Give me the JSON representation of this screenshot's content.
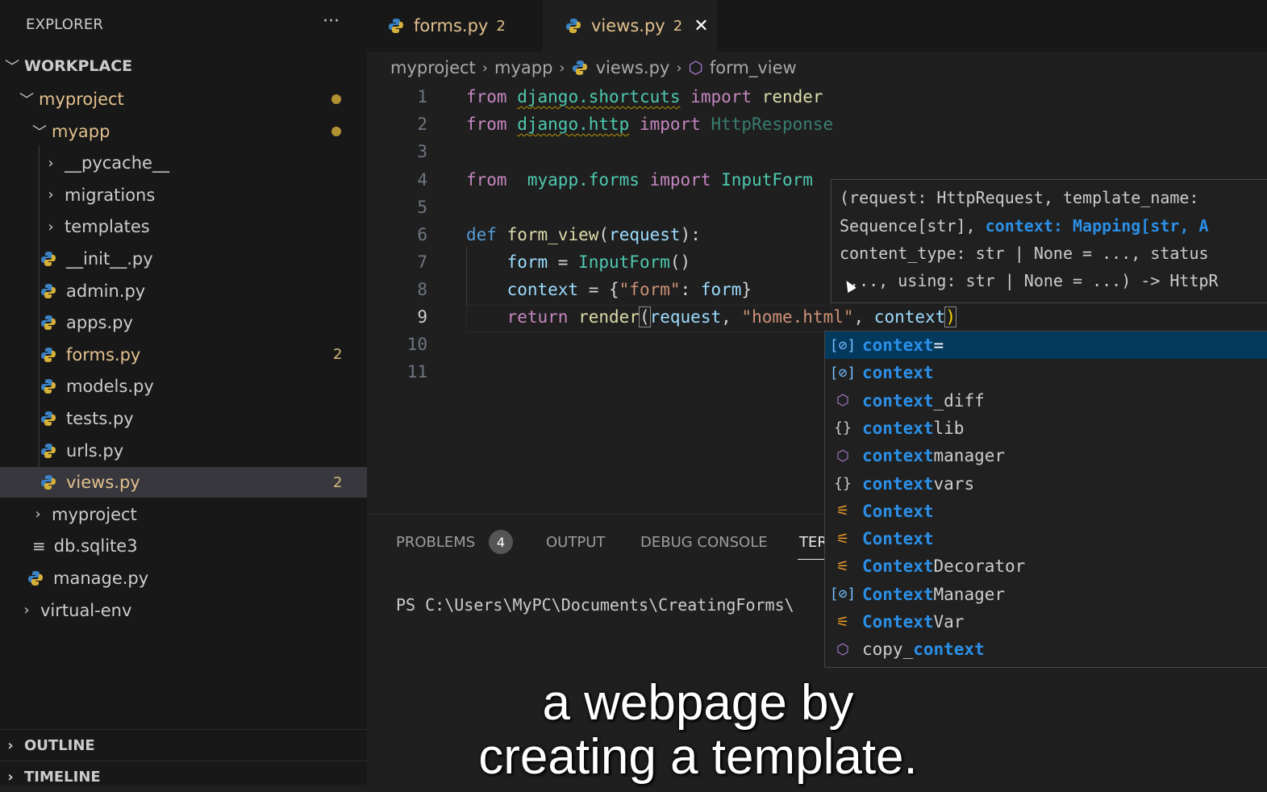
{
  "explorer": {
    "title": "EXPLORER",
    "more": "···",
    "workspace": "WORKPLACE",
    "tree": [
      {
        "label": "myproject",
        "chevron": "﹀",
        "color": "#e2c08d"
      },
      {
        "label": "myapp",
        "chevron": "﹀",
        "color": "#e2c08d"
      },
      {
        "label": "__pycache__",
        "chevron": "›",
        "color": "#cccccc"
      },
      {
        "label": "migrations",
        "chevron": "›",
        "color": "#cccccc"
      },
      {
        "label": "templates",
        "chevron": "›",
        "color": "#cccccc"
      },
      {
        "label": "__init__.py",
        "color": "#cccccc"
      },
      {
        "label": "admin.py",
        "color": "#cccccc"
      },
      {
        "label": "apps.py",
        "color": "#cccccc"
      },
      {
        "label": "forms.py",
        "badge": "2",
        "color": "#e2c08d"
      },
      {
        "label": "models.py",
        "color": "#cccccc"
      },
      {
        "label": "tests.py",
        "color": "#cccccc"
      },
      {
        "label": "urls.py",
        "color": "#cccccc"
      },
      {
        "label": "views.py",
        "badge": "2",
        "color": "#e2c08d"
      },
      {
        "label": "myproject",
        "chevron": "›",
        "color": "#cccccc"
      },
      {
        "label": "db.sqlite3",
        "color": "#cccccc"
      },
      {
        "label": "manage.py",
        "color": "#cccccc"
      },
      {
        "label": "virtual-env",
        "chevron": "›",
        "color": "#cccccc"
      }
    ],
    "outline": "OUTLINE",
    "timeline": "TIMELINE"
  },
  "tabs": [
    {
      "label": "forms.py",
      "count": "2"
    },
    {
      "label": "views.py",
      "count": "2",
      "close": "✕"
    }
  ],
  "breadcrumb": [
    "myproject",
    "myapp",
    "views.py",
    "form_view"
  ],
  "editor": {
    "line_numbers": [
      "1",
      "2",
      "3",
      "4",
      "5",
      "6",
      "7",
      "8",
      "9",
      "10",
      "11"
    ],
    "lines": {
      "l1": [
        "from",
        "django.shortcuts",
        "import",
        "render"
      ],
      "l2": [
        "from",
        "django.http",
        "import",
        "HttpResponse"
      ],
      "l4": [
        "from",
        "myapp.forms",
        "import",
        "InputForm"
      ],
      "l6": [
        "def",
        "form_view",
        "(",
        "request",
        "):"
      ],
      "l7": [
        "form",
        " = ",
        "InputForm",
        "()"
      ],
      "l8": [
        "context",
        " = {",
        "\"form\"",
        ": ",
        "form",
        "}"
      ],
      "l9": [
        "return",
        "render",
        "(",
        "request",
        ", ",
        "\"home.html\"",
        ", ",
        "context",
        ")"
      ]
    }
  },
  "signature_help": {
    "line1": "(request: HttpRequest, template_name: ",
    "line2a": "Sequence[str], ",
    "line2b": "context: Mapping[str, A",
    "line3": "content_type: str | None = ..., status",
    "line4": " ..., using: str | None = ...) -> HttpR"
  },
  "panel": {
    "tabs": [
      "PROBLEMS",
      "OUTPUT",
      "DEBUG CONSOLE",
      "TER"
    ],
    "problems_count": "4",
    "terminal_line": "PS C:\\Users\\MyPC\\Documents\\CreatingForms\\"
  },
  "suggestions": [
    {
      "icon": "[⊘]",
      "type": "var",
      "match": "context",
      "rest": "="
    },
    {
      "icon": "[⊘]",
      "type": "var",
      "match": "context",
      "rest": ""
    },
    {
      "icon": "⬡",
      "type": "cube",
      "match": "context",
      "rest": "_diff"
    },
    {
      "icon": "{}",
      "type": "mod",
      "match": "context",
      "rest": "lib"
    },
    {
      "icon": "⬡",
      "type": "cube",
      "match": "context",
      "rest": "manager"
    },
    {
      "icon": "{}",
      "type": "mod",
      "match": "context",
      "rest": "vars"
    },
    {
      "icon": "⚟",
      "type": "cls",
      "match": "Context",
      "rest": ""
    },
    {
      "icon": "⚟",
      "type": "cls",
      "match": "Context",
      "rest": ""
    },
    {
      "icon": "⚟",
      "type": "cls",
      "match": "Context",
      "rest": "Decorator"
    },
    {
      "icon": "[⊘]",
      "type": "var",
      "match": "Context",
      "rest": "Manager"
    },
    {
      "icon": "⚟",
      "type": "cls",
      "match": "Context",
      "rest": "Var"
    },
    {
      "icon": "⬡",
      "type": "cube",
      "prefix": "copy_",
      "match": "context",
      "rest": ""
    }
  ],
  "subtitles": [
    "a webpage by",
    "creating a template."
  ]
}
